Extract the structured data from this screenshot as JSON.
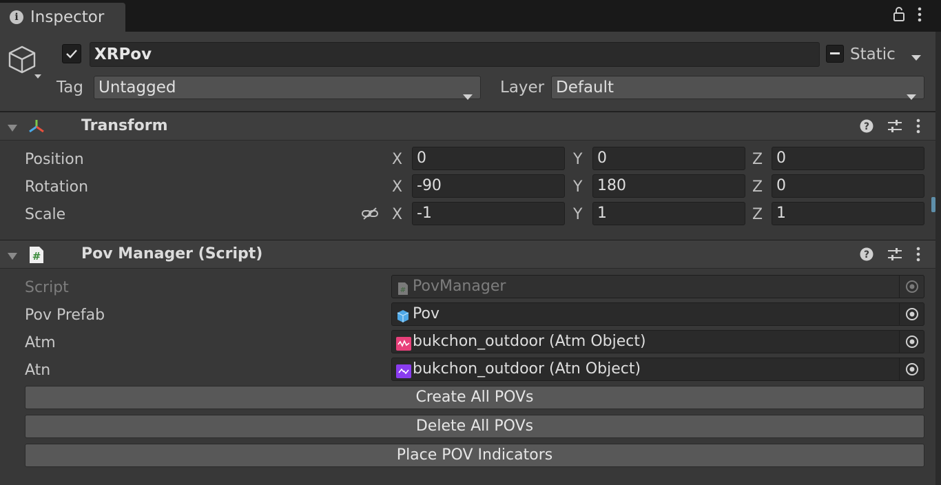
{
  "tab": {
    "label": "Inspector"
  },
  "gameobject": {
    "name": "XRPov",
    "static_label": "Static",
    "tag_label": "Tag",
    "tag_value": "Untagged",
    "layer_label": "Layer",
    "layer_value": "Default"
  },
  "transform": {
    "title": "Transform",
    "rows": [
      {
        "label": "Position",
        "x": "0",
        "y": "0",
        "z": "0"
      },
      {
        "label": "Rotation",
        "x": "-90",
        "y": "180",
        "z": "0"
      },
      {
        "label": "Scale",
        "x": "-1",
        "y": "1",
        "z": "1"
      }
    ],
    "axis_x": "X",
    "axis_y": "Y",
    "axis_z": "Z"
  },
  "pov_manager": {
    "title": "Pov Manager (Script)",
    "fields": [
      {
        "label": "Script",
        "value": "PovManager",
        "icon": "script-icon"
      },
      {
        "label": "Pov Prefab",
        "value": "Pov",
        "icon": "prefab-cube-icon"
      },
      {
        "label": "Atm",
        "value": "bukchon_outdoor (Atm Object)",
        "icon": "atm-asset-icon"
      },
      {
        "label": "Atn",
        "value": "bukchon_outdoor (Atn Object)",
        "icon": "atn-asset-icon"
      }
    ],
    "buttons": {
      "create": "Create All POVs",
      "delete": "Delete All POVs",
      "place": "Place POV Indicators"
    }
  },
  "colors": {
    "panel": "#383838",
    "header": "#3e3e3e",
    "field": "#2a2a2a",
    "button": "#585858",
    "atm_icon": "#e8407a",
    "atn_icon": "#8a3cf0",
    "prefab_icon": "#4fa8e6"
  }
}
